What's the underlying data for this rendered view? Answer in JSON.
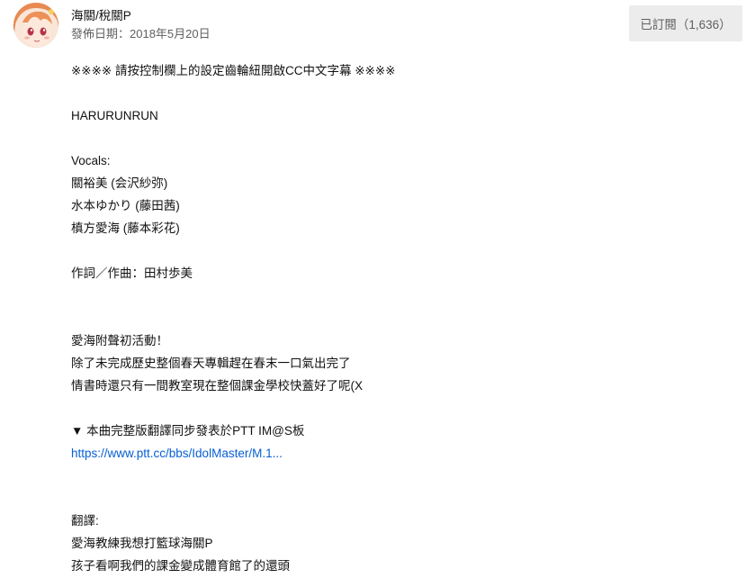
{
  "channel": {
    "name": "海關/稅關P",
    "publish_date": "發佈日期：2018年5月20日"
  },
  "subscribe": {
    "label": "已訂閱（1,636）"
  },
  "description": {
    "lines": [
      "※※※※ 請按控制欄上的設定齒輪紐開啟CC中文字幕 ※※※※",
      "",
      "HARURUNRUN",
      "",
      "Vocals:",
      "關裕美 (会沢紗弥)",
      "水本ゆかり (藤田茜)",
      "槙方愛海 (藤本彩花)",
      "",
      "作詞／作曲：田村歩美",
      "",
      "",
      "愛海附聲初活動！",
      "除了未完成歷史整個春天專輯趕在春末一口氣出完了",
      "情書時還只有一間教室現在整個課金學校快蓋好了呢(X",
      "",
      "▼ 本曲完整版翻譯同步發表於PTT IM@S板",
      "https://www.ptt.cc/bbs/IdolMaster/M.1...",
      "",
      "",
      "翻譯:",
      "愛海教練我想打籃球海關P",
      "孩子看啊我們的課金變成體育館了的還頭"
    ],
    "link_index": 17
  }
}
